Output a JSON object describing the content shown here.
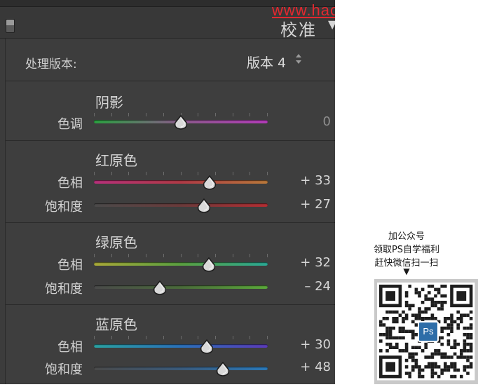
{
  "watermark": {
    "text": "www.haoyidanshegi.com"
  },
  "panel": {
    "title": "校准",
    "process": {
      "label": "处理版本:",
      "value": "版本 4"
    },
    "sections": [
      {
        "title": "阴影",
        "rows": [
          {
            "label": "色调",
            "value": 0,
            "display": "0",
            "gradient": [
              "#2aa040",
              "#8a5a8a",
              "#b23bb8"
            ]
          }
        ]
      },
      {
        "title": "红原色",
        "rows": [
          {
            "label": "色相",
            "value": 33,
            "display": "+ 33",
            "gradient": [
              "#b6307a",
              "#b03a46",
              "#b8783a"
            ]
          },
          {
            "label": "饱和度",
            "value": 27,
            "display": "+ 27",
            "gradient": [
              "#4a4a4a",
              "#6a3a3a",
              "#b32d32"
            ]
          }
        ]
      },
      {
        "title": "绿原色",
        "rows": [
          {
            "label": "色相",
            "value": 32,
            "display": "+ 32",
            "gradient": [
              "#a8a838",
              "#5aa040",
              "#2aa894"
            ]
          },
          {
            "label": "饱和度",
            "value": -24,
            "display": "– 24",
            "gradient": [
              "#4a4a4a",
              "#4a6a3a",
              "#5aa83a"
            ]
          }
        ]
      },
      {
        "title": "蓝原色",
        "rows": [
          {
            "label": "色相",
            "value": 30,
            "display": "+ 30",
            "gradient": [
              "#2aa0a0",
              "#2a70b8",
              "#5a3ab8"
            ]
          },
          {
            "label": "饱和度",
            "value": 48,
            "display": "+ 48",
            "gradient": [
              "#4a4a4a",
              "#3a5a7a",
              "#2a78b8"
            ]
          }
        ]
      }
    ]
  },
  "promo": {
    "lines": [
      "加公众号",
      "领取PS自学福利",
      "赶快微信扫一扫"
    ],
    "arrow": "▼",
    "badge": "Ps"
  }
}
